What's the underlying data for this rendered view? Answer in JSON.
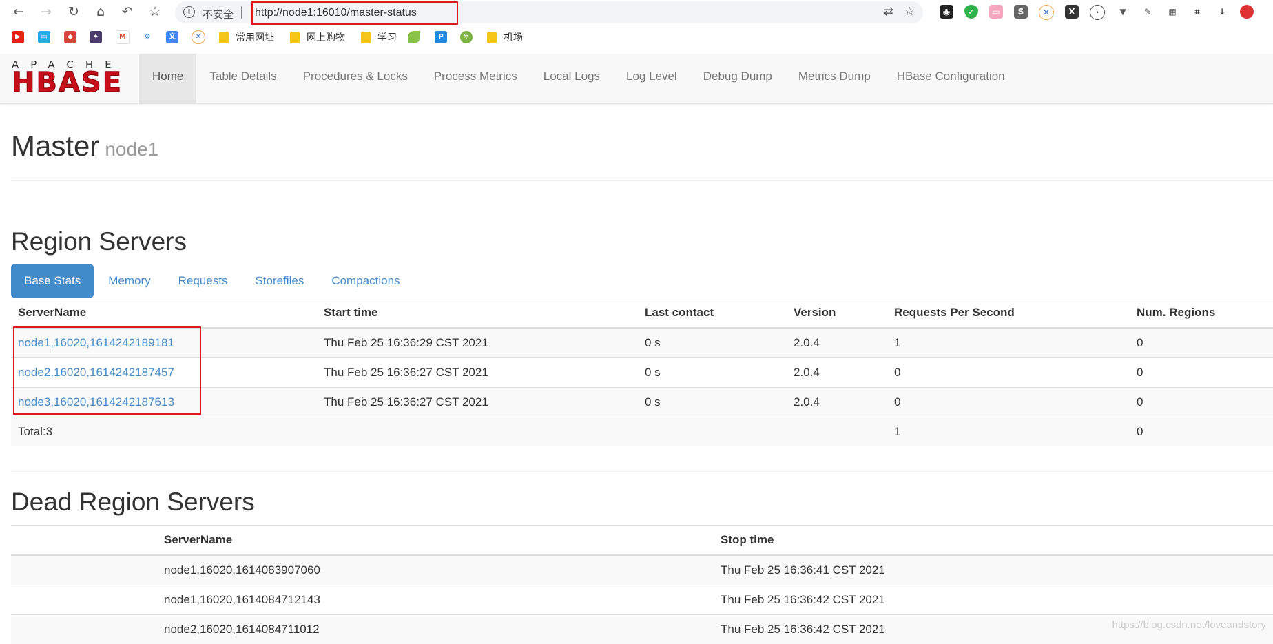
{
  "browser": {
    "insecure_label": "不安全",
    "url": "http://node1:16010/master-status"
  },
  "bookmarks": [
    {
      "label": "常用网址"
    },
    {
      "label": "网上购物"
    },
    {
      "label": "学习"
    },
    {
      "label": "机场"
    }
  ],
  "nav": {
    "items": [
      "Home",
      "Table Details",
      "Procedures & Locks",
      "Process Metrics",
      "Local Logs",
      "Log Level",
      "Debug Dump",
      "Metrics Dump",
      "HBase Configuration"
    ],
    "active": "Home",
    "logo_top": "APACHE",
    "logo_main": "HBASE"
  },
  "page": {
    "title": "Master",
    "subtitle": "node1"
  },
  "region_servers": {
    "heading": "Region Servers",
    "tabs": [
      "Base Stats",
      "Memory",
      "Requests",
      "Storefiles",
      "Compactions"
    ],
    "active_tab": "Base Stats",
    "columns": [
      "ServerName",
      "Start time",
      "Last contact",
      "Version",
      "Requests Per Second",
      "Num. Regions"
    ],
    "rows": [
      {
        "server": "node1,16020,1614242189181",
        "start": "Thu Feb 25 16:36:29 CST 2021",
        "last_contact": "0 s",
        "version": "2.0.4",
        "rps": "1",
        "regions": "0"
      },
      {
        "server": "node2,16020,1614242187457",
        "start": "Thu Feb 25 16:36:27 CST 2021",
        "last_contact": "0 s",
        "version": "2.0.4",
        "rps": "0",
        "regions": "0"
      },
      {
        "server": "node3,16020,1614242187613",
        "start": "Thu Feb 25 16:36:27 CST 2021",
        "last_contact": "0 s",
        "version": "2.0.4",
        "rps": "0",
        "regions": "0"
      }
    ],
    "total": {
      "label": "Total:3",
      "rps": "1",
      "regions": "0"
    }
  },
  "dead_region_servers": {
    "heading": "Dead Region Servers",
    "columns": [
      "ServerName",
      "Stop time"
    ],
    "rows": [
      {
        "server": "node1,16020,1614083907060",
        "stop": "Thu Feb 25 16:36:41 CST 2021"
      },
      {
        "server": "node1,16020,1614084712143",
        "stop": "Thu Feb 25 16:36:42 CST 2021"
      },
      {
        "server": "node2,16020,1614084711012",
        "stop": "Thu Feb 25 16:36:42 CST 2021"
      }
    ]
  },
  "watermark": "https://blog.csdn.net/loveandstory",
  "colors": {
    "link": "#428bca",
    "accent": "#428bca",
    "highlight": "#e0191e",
    "logo_red": "#c40f1a"
  }
}
